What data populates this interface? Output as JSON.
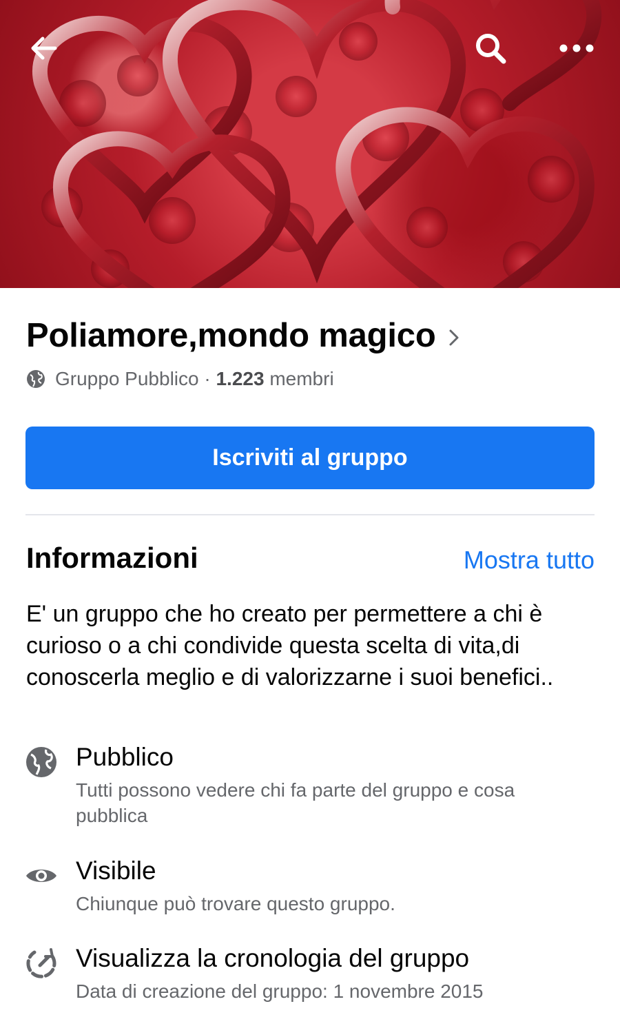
{
  "cover": {
    "image_name": "red-hearts-roses-cover",
    "back_icon": "arrow-left-icon",
    "search_icon": "search-icon",
    "more_icon": "more-horizontal-icon"
  },
  "group": {
    "name": "Poliamore,mondo magico",
    "privacy_label": "Gruppo Pubblico",
    "separator": " · ",
    "member_count": "1.223",
    "members_label": "membri",
    "join_label": "Iscriviti al gruppo"
  },
  "about": {
    "title": "Informazioni",
    "show_all": "Mostra tutto",
    "description": "E' un gruppo che ho creato per permettere a chi è curioso o a chi condivide questa scelta di vita,di conoscerla meglio e di valorizzarne i suoi benefici..",
    "items": [
      {
        "icon": "globe-icon",
        "title": "Pubblico",
        "subtitle": "Tutti possono vedere chi fa parte del gruppo e cosa pubblica"
      },
      {
        "icon": "eye-icon",
        "title": "Visibile",
        "subtitle": "Chiunque può trovare questo gruppo."
      },
      {
        "icon": "history-icon",
        "title": "Visualizza la cronologia del gruppo",
        "subtitle": "Data di creazione del gruppo: 1 novembre 2015"
      }
    ]
  },
  "colors": {
    "primary": "#1877f2",
    "text": "#050505",
    "secondary_text": "#65676b",
    "divider": "#e4e6eb"
  }
}
